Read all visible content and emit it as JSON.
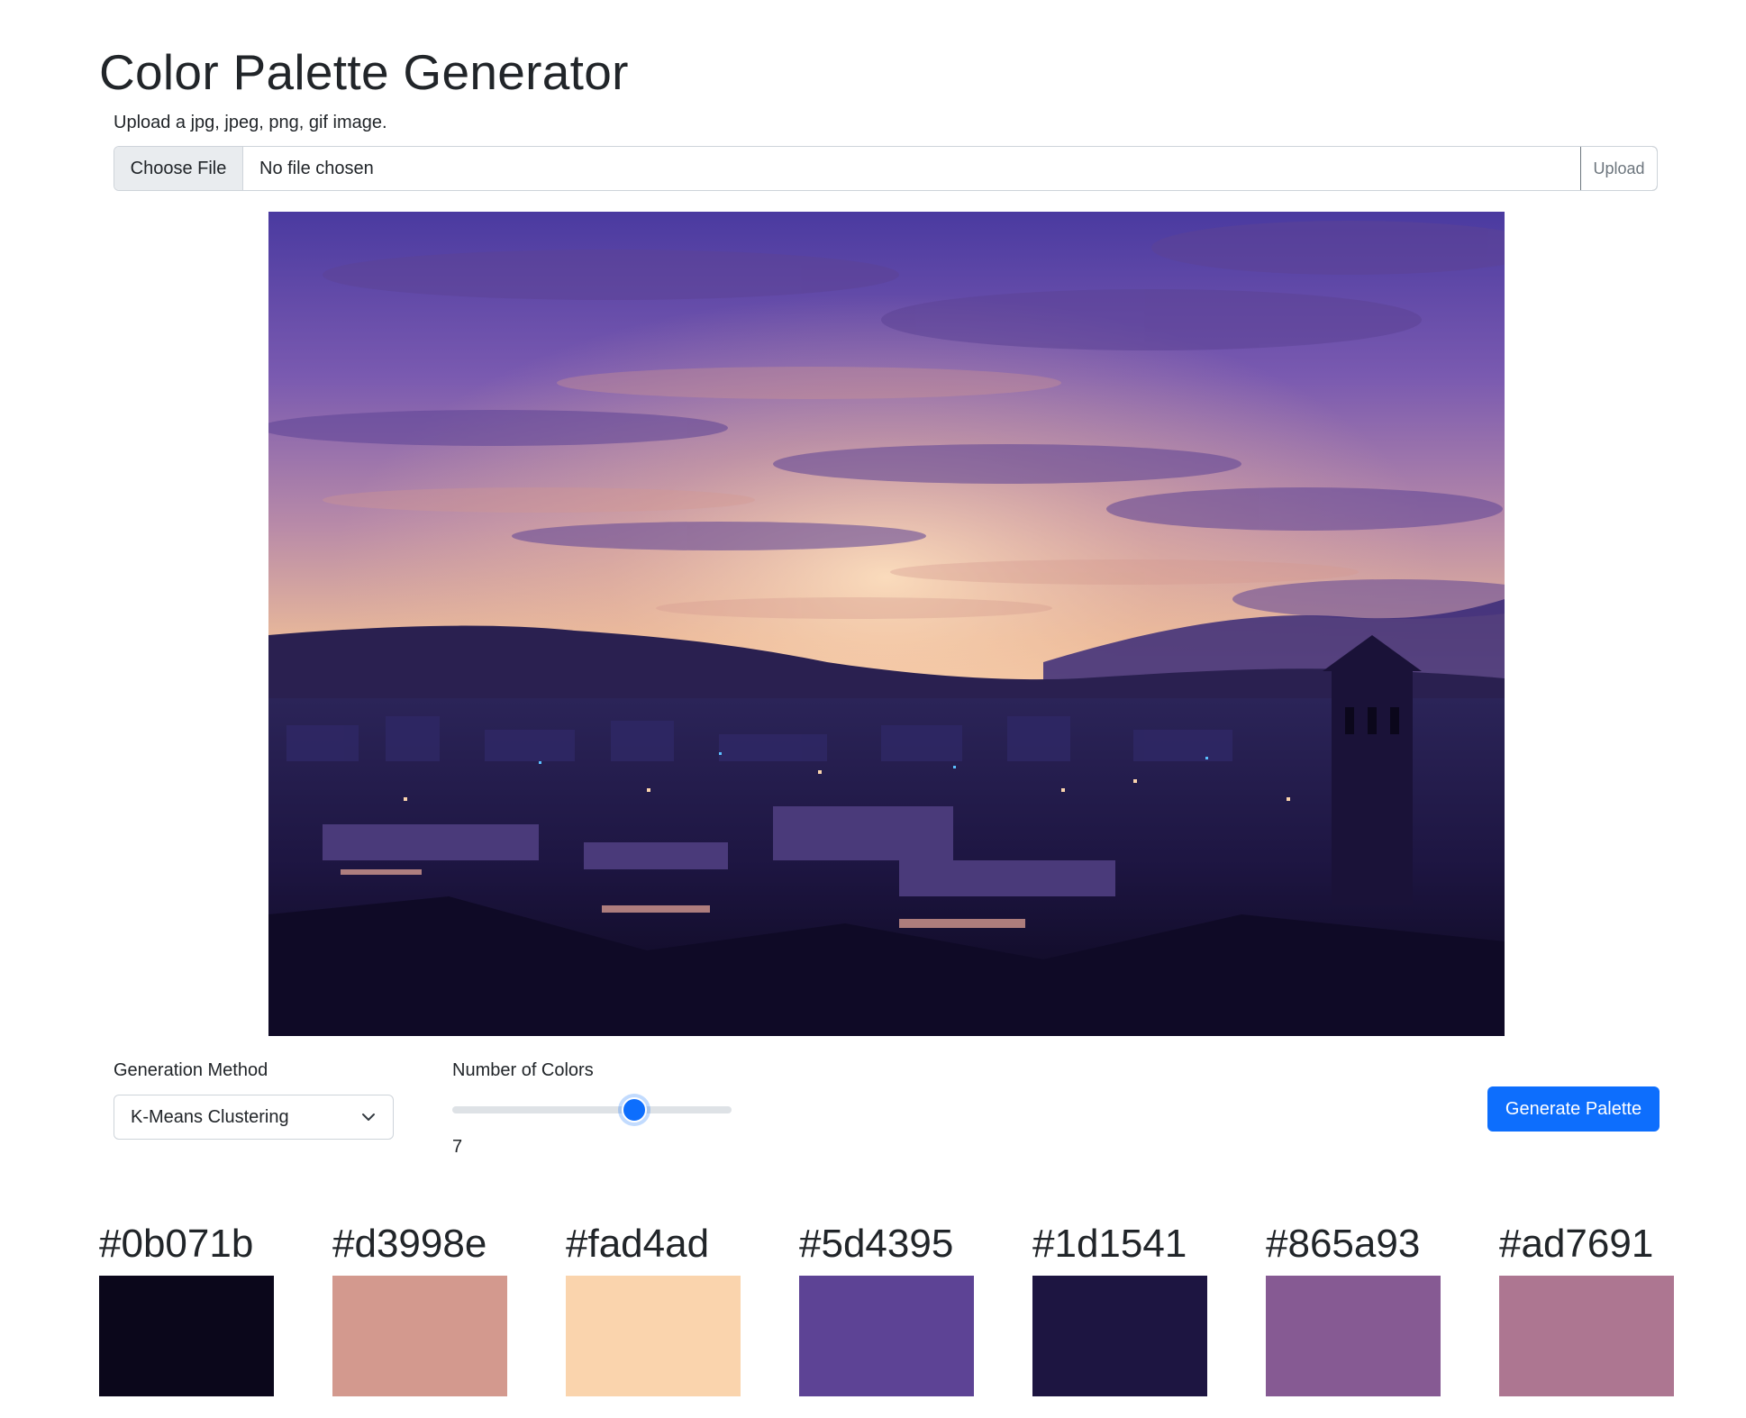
{
  "header": {
    "title": "Color Palette Generator",
    "upload_hint": "Upload a jpg, jpeg, png, gif image."
  },
  "file_input": {
    "button_label": "Choose File",
    "status": "No file chosen",
    "upload_label": "Upload"
  },
  "preview_image": {
    "subject": "sunset sky over city skyline with church tower"
  },
  "controls": {
    "method_label": "Generation Method",
    "method_value": "K-Means Clustering",
    "count_label": "Number of Colors",
    "count_value": "7",
    "count_fraction": 0.65,
    "generate_label": "Generate Palette"
  },
  "palette": [
    {
      "hex": "#0b071b",
      "color": "#0b071b"
    },
    {
      "hex": "#d3998e",
      "color": "#d3998e"
    },
    {
      "hex": "#fad4ad",
      "color": "#fad4ad"
    },
    {
      "hex": "#5d4395",
      "color": "#5d4395"
    },
    {
      "hex": "#1d1541",
      "color": "#1d1541"
    },
    {
      "hex": "#865a93",
      "color": "#865a93"
    },
    {
      "hex": "#ad7691",
      "color": "#ad7691"
    }
  ],
  "icons": {
    "select_chevron": "chevron-down-icon"
  }
}
